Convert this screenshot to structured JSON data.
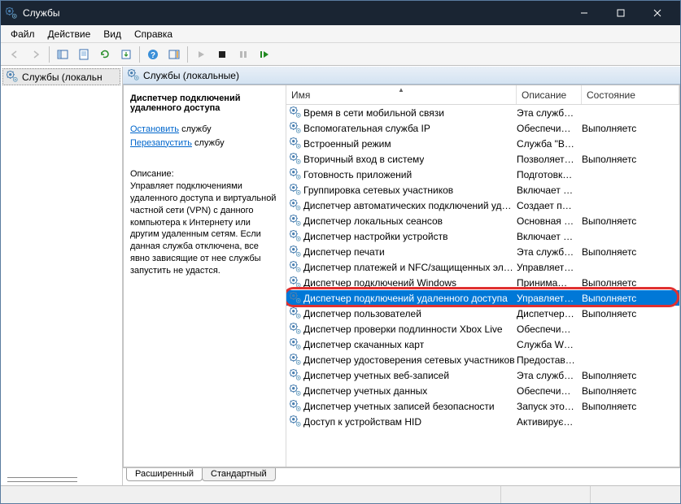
{
  "window": {
    "title": "Службы",
    "controls": {
      "minimize": "–",
      "maximize": "☐",
      "close": "✕"
    }
  },
  "menu": {
    "file": "Файл",
    "action": "Действие",
    "view": "Вид",
    "help": "Справка"
  },
  "toolbar": {
    "back": "Назад",
    "forward": "Вперёд",
    "up": "Вверх",
    "show_hide": "Показать/скрыть",
    "properties": "Свойства",
    "refresh": "Обновить",
    "export": "Экспорт",
    "help": "Справка",
    "extra": "Доп.",
    "start_svc": "Запустить",
    "stop_svc": "Остановить",
    "pause_svc": "Пауза",
    "restart_svc": "Перезапустить"
  },
  "tree": {
    "root": "Службы (локальн"
  },
  "right_header": "Службы (локальные)",
  "columns": {
    "name": "Имя",
    "description": "Описание",
    "state": "Состояние"
  },
  "detail": {
    "title": "Диспетчер подключений удаленного доступа",
    "stop_link": "Остановить",
    "stop_suffix": " службу",
    "restart_link": "Перезапустить",
    "restart_suffix": " службу",
    "desc_label": "Описание:",
    "desc_text": "Управляет подключениями удаленного доступа и виртуальной частной сети (VPN) с данного компьютера к Интернету или другим удаленным сетям. Если данная служба отключена, все явно зависящие от нее службы запустить не удастся."
  },
  "services": [
    {
      "name": "Время в сети мобильной связи",
      "desc": "Эта служб…",
      "state": ""
    },
    {
      "name": "Вспомогательная служба IP",
      "desc": "Обеспечи…",
      "state": "Выполняетс"
    },
    {
      "name": "Встроенный режим",
      "desc": "Служба \"В…",
      "state": ""
    },
    {
      "name": "Вторичный вход в систему",
      "desc": "Позволяет…",
      "state": "Выполняетс"
    },
    {
      "name": "Готовность приложений",
      "desc": "Подготовк…",
      "state": ""
    },
    {
      "name": "Группировка сетевых участников",
      "desc": "Включает …",
      "state": ""
    },
    {
      "name": "Диспетчер автоматических подключений удал…",
      "desc": "Создает п…",
      "state": ""
    },
    {
      "name": "Диспетчер локальных сеансов",
      "desc": "Основная …",
      "state": "Выполняетс"
    },
    {
      "name": "Диспетчер настройки устройств",
      "desc": "Включает …",
      "state": ""
    },
    {
      "name": "Диспетчер печати",
      "desc": "Эта служб…",
      "state": "Выполняетс"
    },
    {
      "name": "Диспетчер платежей и NFC/защищенных эле…",
      "desc": "Управляет…",
      "state": ""
    },
    {
      "name": "Диспетчер подключений Windows",
      "desc": "Принима…",
      "state": "Выполняетс"
    },
    {
      "name": "Диспетчер подключений удаленного доступа",
      "desc": "Управляет…",
      "state": "Выполняетс",
      "selected": true
    },
    {
      "name": "Диспетчер пользователей",
      "desc": "Диспетчер…",
      "state": "Выполняетс"
    },
    {
      "name": "Диспетчер проверки подлинности Xbox Live",
      "desc": "Обеспечи…",
      "state": ""
    },
    {
      "name": "Диспетчер скачанных карт",
      "desc": "Служба W…",
      "state": ""
    },
    {
      "name": "Диспетчер удостоверения сетевых участников",
      "desc": "Предостав…",
      "state": ""
    },
    {
      "name": "Диспетчер учетных веб-записей",
      "desc": "Эта служб…",
      "state": "Выполняетс"
    },
    {
      "name": "Диспетчер учетных данных",
      "desc": "Обеспечи…",
      "state": "Выполняетс"
    },
    {
      "name": "Диспетчер учетных записей безопасности",
      "desc": "Запуск это…",
      "state": "Выполняетс"
    },
    {
      "name": "Доступ к устройствам HID",
      "desc": "Активирує…",
      "state": ""
    }
  ],
  "tabs": {
    "extended": "Расширенный",
    "standard": "Стандартный"
  }
}
